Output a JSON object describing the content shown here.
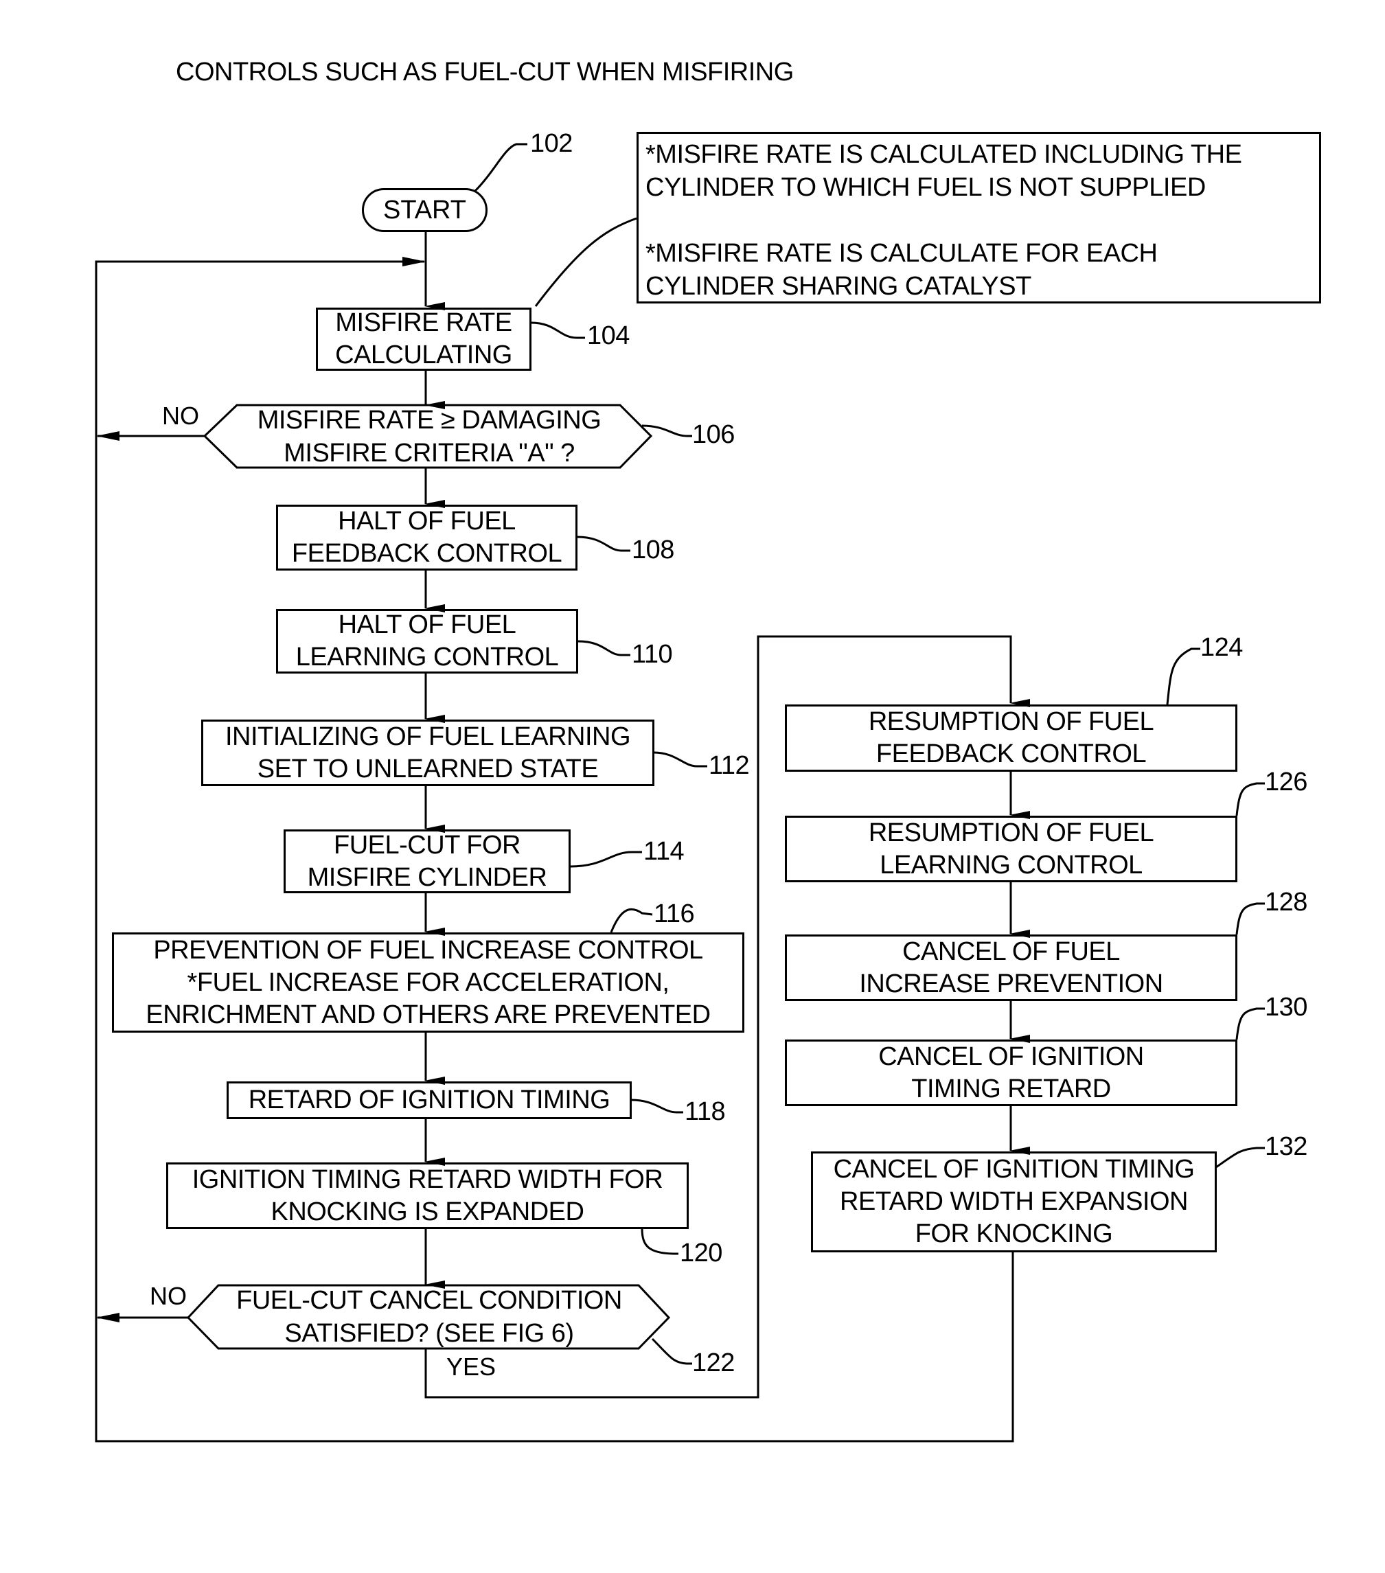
{
  "title": "CONTROLS SUCH AS FUEL-CUT WHEN MISFIRING",
  "start": {
    "label": "START",
    "ref": "102"
  },
  "note": {
    "lines_1": [
      "*MISFIRE RATE IS CALCULATED INCLUDING THE",
      "CYLINDER TO WHICH FUEL IS NOT SUPPLIED"
    ],
    "lines_2": [
      "*MISFIRE RATE IS CALCULATE FOR EACH",
      "CYLINDER SHARING CATALYST"
    ]
  },
  "steps": {
    "s104": {
      "ref": "104",
      "lines": [
        "MISFIRE RATE",
        "CALCULATING"
      ]
    },
    "s106": {
      "ref": "106",
      "lines": [
        "MISFIRE RATE ≥ DAMAGING",
        "MISFIRE CRITERIA \"A\" ?"
      ],
      "no_label": "NO"
    },
    "s108": {
      "ref": "108",
      "lines": [
        "HALT OF FUEL",
        "FEEDBACK CONTROL"
      ]
    },
    "s110": {
      "ref": "110",
      "lines": [
        "HALT OF FUEL",
        "LEARNING CONTROL"
      ]
    },
    "s112": {
      "ref": "112",
      "lines": [
        "INITIALIZING OF FUEL LEARNING",
        "SET TO UNLEARNED STATE"
      ]
    },
    "s114": {
      "ref": "114",
      "lines": [
        "FUEL-CUT FOR",
        "MISFIRE CYLINDER"
      ]
    },
    "s116": {
      "ref": "116",
      "lines": [
        "PREVENTION OF FUEL INCREASE CONTROL",
        "*FUEL INCREASE FOR ACCELERATION,",
        "ENRICHMENT AND OTHERS ARE PREVENTED"
      ]
    },
    "s118": {
      "ref": "118",
      "lines": [
        "RETARD OF IGNITION TIMING"
      ]
    },
    "s120": {
      "ref": "120",
      "lines": [
        "IGNITION TIMING RETARD WIDTH FOR",
        "KNOCKING IS EXPANDED"
      ]
    },
    "s122": {
      "ref": "122",
      "lines": [
        "FUEL-CUT CANCEL CONDITION",
        "SATISFIED? (SEE FIG 6)"
      ],
      "no_label": "NO",
      "yes_label": "YES"
    },
    "s124": {
      "ref": "124",
      "lines": [
        "RESUMPTION OF FUEL",
        "FEEDBACK CONTROL"
      ]
    },
    "s126": {
      "ref": "126",
      "lines": [
        "RESUMPTION OF FUEL",
        "LEARNING CONTROL"
      ]
    },
    "s128": {
      "ref": "128",
      "lines": [
        "CANCEL OF FUEL",
        "INCREASE PREVENTION"
      ]
    },
    "s130": {
      "ref": "130",
      "lines": [
        "CANCEL OF IGNITION",
        "TIMING RETARD"
      ]
    },
    "s132": {
      "ref": "132",
      "lines": [
        "CANCEL OF IGNITION TIMING",
        "RETARD WIDTH EXPANSION",
        "FOR KNOCKING"
      ]
    }
  }
}
